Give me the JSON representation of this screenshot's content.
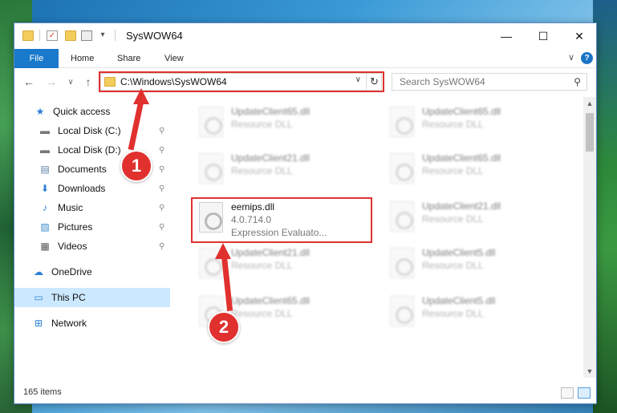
{
  "window": {
    "title": "SysWOW64",
    "accent_color": "#1979ca",
    "controls": {
      "minimize": "—",
      "maximize": "☐",
      "close": "✕"
    }
  },
  "ribbon": {
    "tabs": [
      "File",
      "Home",
      "Share",
      "View"
    ],
    "help_icon": "?",
    "collapse_icon": "∨"
  },
  "nav": {
    "back_icon": "←",
    "forward_icon": "→",
    "recent_icon": "∨",
    "up_icon": "↑",
    "address": "C:\\Windows\\SysWOW64",
    "address_dropdown_icon": "∨",
    "refresh_icon": "↻",
    "search_placeholder": "Search SysWOW64",
    "search_icon": "⚲"
  },
  "sidebar": {
    "items": [
      {
        "label": "Quick access",
        "icon": "★",
        "pinned": false
      },
      {
        "label": "Local Disk (C:)",
        "icon": "▬",
        "pinned": true
      },
      {
        "label": "Local Disk (D:)",
        "icon": "▬",
        "pinned": true
      },
      {
        "label": "Documents",
        "icon": "▤",
        "pinned": true
      },
      {
        "label": "Downloads",
        "icon": "⬇",
        "pinned": true
      },
      {
        "label": "Music",
        "icon": "♪",
        "pinned": true
      },
      {
        "label": "Pictures",
        "icon": "▨",
        "pinned": true
      },
      {
        "label": "Videos",
        "icon": "▦",
        "pinned": true
      },
      {
        "label": "OneDrive",
        "icon": "☁",
        "pinned": false
      },
      {
        "label": "This PC",
        "icon": "▭",
        "pinned": false
      },
      {
        "label": "Network",
        "icon": "⊞",
        "pinned": false
      }
    ],
    "pin_icon": "📌"
  },
  "files": {
    "left": [
      {
        "name": "UpdateClient65.dll",
        "type": "Resource DLL"
      },
      {
        "name": "UpdateClient21.dll",
        "type": "Resource DLL"
      },
      {
        "name": "eemips.dll",
        "version": "4.0.714.0",
        "description": "Expression Evaluato..."
      },
      {
        "name": "UpdateClient21.dll",
        "type": "Resource DLL"
      },
      {
        "name": "UpdateClient65.dll",
        "type": "Resource DLL"
      }
    ],
    "right": [
      {
        "name": "UpdateClient65.dll",
        "type": "Resource DLL"
      },
      {
        "name": "UpdateClient65.dll",
        "type": "Resource DLL"
      },
      {
        "name": "UpdateClient21.dll",
        "type": "Resource DLL"
      },
      {
        "name": "UpdateClient5.dll",
        "type": "Resource DLL"
      },
      {
        "name": "UpdateClient5.dll",
        "type": "Resource DLL"
      }
    ]
  },
  "status": {
    "item_count": "165 items"
  },
  "annotations": {
    "badge_1": "1",
    "badge_2": "2",
    "color": "#e0312f"
  }
}
